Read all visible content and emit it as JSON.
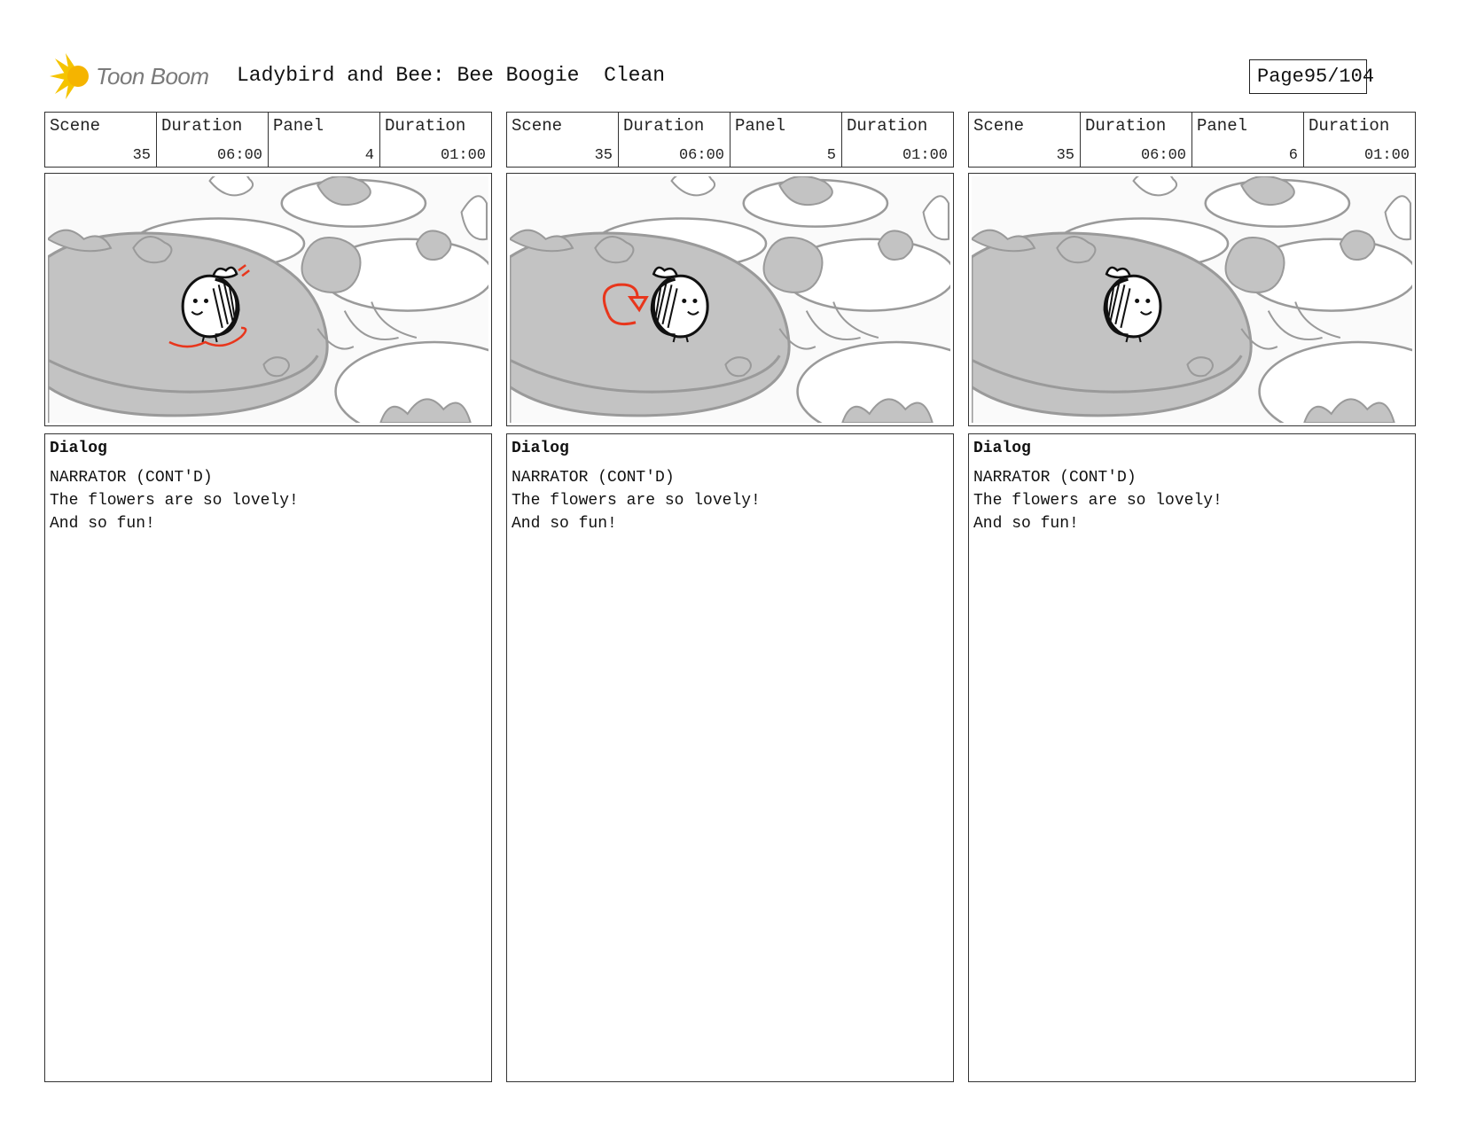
{
  "header": {
    "logo_text": "Toon Boom",
    "title": "Ladybird and Bee: Bee Boogie  Clean",
    "page_label": "Page",
    "page_value": "95/104"
  },
  "colors": {
    "accent_red": "#e8361c",
    "gray_fill": "#c3c3c3",
    "line_gray": "#9a9a9a",
    "logo_yellow": "#f5c400"
  },
  "panels": [
    {
      "scene_label": "Scene",
      "scene": "35",
      "scene_duration_label": "Duration",
      "scene_duration": "06:00",
      "panel_label": "Panel",
      "panel": "4",
      "panel_duration_label": "Duration",
      "panel_duration": "01:00",
      "dialog_label": "Dialog",
      "dialog_lines": [
        "NARRATOR (CONT'D)",
        "The flowers are so lovely!",
        "And so fun!"
      ],
      "bee_facing": "left",
      "annotation": "red-motion-marks"
    },
    {
      "scene_label": "Scene",
      "scene": "35",
      "scene_duration_label": "Duration",
      "scene_duration": "06:00",
      "panel_label": "Panel",
      "panel": "5",
      "panel_duration_label": "Duration",
      "panel_duration": "01:00",
      "dialog_label": "Dialog",
      "dialog_lines": [
        "NARRATOR (CONT'D)",
        "The flowers are so lovely!",
        "And so fun!"
      ],
      "bee_facing": "right",
      "annotation": "red-turn-arrow"
    },
    {
      "scene_label": "Scene",
      "scene": "35",
      "scene_duration_label": "Duration",
      "scene_duration": "06:00",
      "panel_label": "Panel",
      "panel": "6",
      "panel_duration_label": "Duration",
      "panel_duration": "01:00",
      "dialog_label": "Dialog",
      "dialog_lines": [
        "NARRATOR (CONT'D)",
        "The flowers are so lovely!",
        "And so fun!"
      ],
      "bee_facing": "right",
      "annotation": "none"
    }
  ]
}
